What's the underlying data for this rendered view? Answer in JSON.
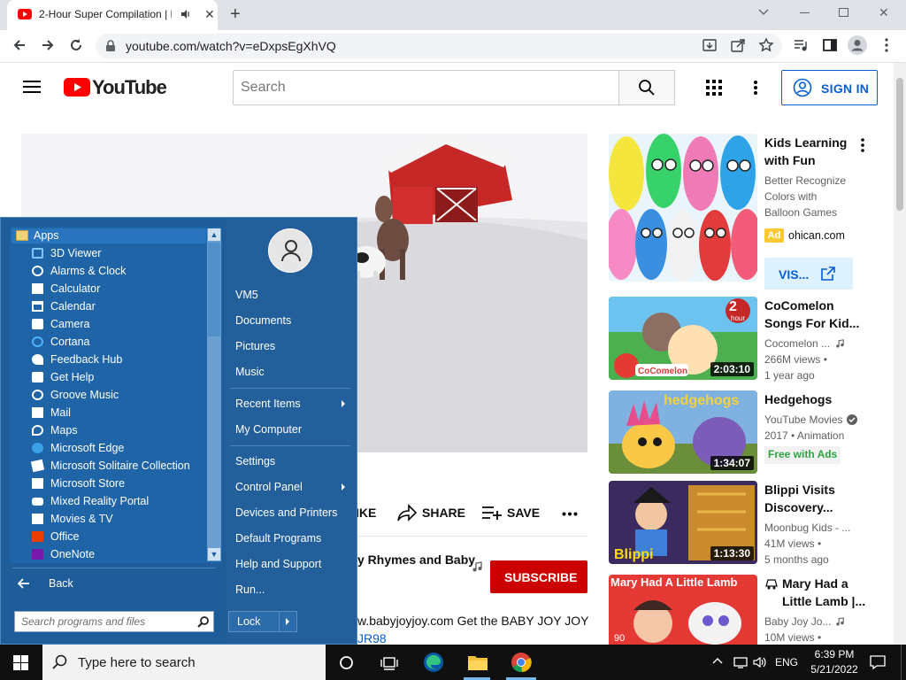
{
  "browser": {
    "tab_title": "2-Hour Super Compilation | Bab",
    "url": "youtube.com/watch?v=eDxpsEgXhVQ"
  },
  "youtube": {
    "logo_text": "YouTube",
    "search_placeholder": "Search",
    "signin_label": "SIGN IN",
    "actions": {
      "like": "IKE",
      "share": "SHARE",
      "save": "SAVE"
    },
    "channel_line": "y Rhymes and Baby",
    "subscribe_label": "SUBSCRIBE",
    "description_line": "w.babyjoyjoy.com Get the BABY JOY JOY",
    "description_link": "JR98"
  },
  "recommendations": [
    {
      "title": "Kids Learning with Fun",
      "meta": [
        "Better Recognize",
        "Colors with",
        "Balloon Games"
      ],
      "ad_badge": "Ad",
      "ad_domain": "ohican.com",
      "visit_label": "VIS..."
    },
    {
      "title": "CoComelon Songs For Kid...",
      "channel": "Cocomelon ...",
      "views": "266M views •",
      "age": "1 year ago",
      "duration": "2:03:10",
      "badge_text": "2",
      "badge_sub": "hour"
    },
    {
      "title": "Hedgehogs",
      "channel": "YouTube Movies",
      "year_genre": "2017 • Animation",
      "free": "Free with Ads",
      "duration": "1:34:07",
      "thumb_text": "hedgehogs"
    },
    {
      "title": "Blippi Visits Discovery...",
      "channel": "Moonbug Kids - ...",
      "views": "41M views •",
      "age": "5 months ago",
      "duration": "1:13:30",
      "thumb_text": "Blippi"
    },
    {
      "title": "Mary Had a Little Lamb |...",
      "channel": "Baby Joy Jo...",
      "views": "10M views •",
      "duration_partial": "90",
      "thumb_text": "Mary Had A Little Lamb"
    }
  ],
  "start_menu": {
    "apps_header": "Apps",
    "apps": [
      "3D Viewer",
      "Alarms & Clock",
      "Calculator",
      "Calendar",
      "Camera",
      "Cortana",
      "Feedback Hub",
      "Get Help",
      "Groove Music",
      "Mail",
      "Maps",
      "Microsoft Edge",
      "Microsoft Solitaire Collection",
      "Microsoft Store",
      "Mixed Reality Portal",
      "Movies & TV",
      "Office",
      "OneNote"
    ],
    "back_label": "Back",
    "search_placeholder": "Search programs and files",
    "right_items": {
      "user": "VM5",
      "documents": "Documents",
      "pictures": "Pictures",
      "music": "Music",
      "recent": "Recent Items",
      "computer": "My Computer",
      "settings": "Settings",
      "control_panel": "Control Panel",
      "devices": "Devices and Printers",
      "default_programs": "Default Programs",
      "help": "Help and Support",
      "run": "Run..."
    },
    "lock_label": "Lock"
  },
  "taskbar": {
    "search_text": "Type here to search",
    "language": "ENG",
    "time": "6:39 PM",
    "date": "5/21/2022"
  },
  "colors": {
    "youtube_red": "#ff0000",
    "signin_blue": "#065fd4",
    "start_menu_blue": "#1e5d9a"
  }
}
